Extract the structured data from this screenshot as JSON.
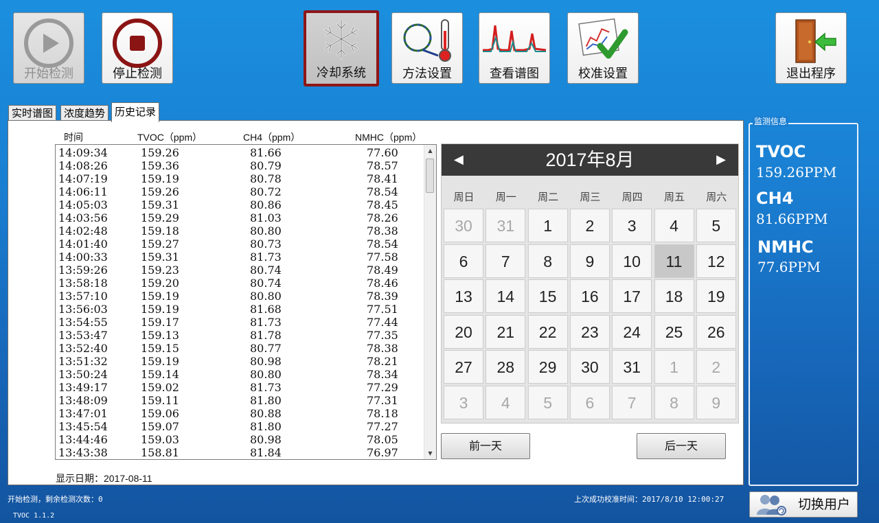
{
  "toolbar": {
    "start": "开始检测",
    "stop": "停止检测",
    "cooling": "冷却系统",
    "method": "方法设置",
    "spectrum": "查看谱图",
    "calibration": "校准设置",
    "exit": "退出程序"
  },
  "tabs": [
    "实时谱图",
    "浓度趋势",
    "历史记录"
  ],
  "history": {
    "columns": [
      "时间",
      "TVOC（ppm）",
      "CH4（ppm）",
      "NMHC（ppm）"
    ],
    "rows": [
      [
        "14:09:34",
        "159.26",
        "81.66",
        "77.60"
      ],
      [
        "14:08:26",
        "159.36",
        "80.79",
        "78.57"
      ],
      [
        "14:07:19",
        "159.19",
        "80.78",
        "78.41"
      ],
      [
        "14:06:11",
        "159.26",
        "80.72",
        "78.54"
      ],
      [
        "14:05:03",
        "159.31",
        "80.86",
        "78.45"
      ],
      [
        "14:03:56",
        "159.29",
        "81.03",
        "78.26"
      ],
      [
        "14:02:48",
        "159.18",
        "80.80",
        "78.38"
      ],
      [
        "14:01:40",
        "159.27",
        "80.73",
        "78.54"
      ],
      [
        "14:00:33",
        "159.31",
        "81.73",
        "77.58"
      ],
      [
        "13:59:26",
        "159.23",
        "80.74",
        "78.49"
      ],
      [
        "13:58:18",
        "159.20",
        "80.74",
        "78.46"
      ],
      [
        "13:57:10",
        "159.19",
        "80.80",
        "78.39"
      ],
      [
        "13:56:03",
        "159.19",
        "81.68",
        "77.51"
      ],
      [
        "13:54:55",
        "159.17",
        "81.73",
        "77.44"
      ],
      [
        "13:53:47",
        "159.13",
        "81.78",
        "77.35"
      ],
      [
        "13:52:40",
        "159.15",
        "80.77",
        "78.38"
      ],
      [
        "13:51:32",
        "159.19",
        "80.98",
        "78.21"
      ],
      [
        "13:50:24",
        "159.14",
        "80.80",
        "78.34"
      ],
      [
        "13:49:17",
        "159.02",
        "81.73",
        "77.29"
      ],
      [
        "13:48:09",
        "159.11",
        "81.80",
        "77.31"
      ],
      [
        "13:47:01",
        "159.06",
        "80.88",
        "78.18"
      ],
      [
        "13:45:54",
        "159.07",
        "81.80",
        "77.27"
      ],
      [
        "13:44:46",
        "159.03",
        "80.98",
        "78.05"
      ],
      [
        "13:43:38",
        "158.81",
        "81.84",
        "76.97"
      ]
    ]
  },
  "display_date": "显示日期：2017-08-11",
  "calendar": {
    "title": "2017年8月",
    "prev_icon": "◀",
    "next_icon": "▶",
    "weekdays": [
      "周日",
      "周一",
      "周二",
      "周三",
      "周四",
      "周五",
      "周六"
    ],
    "days": [
      "30",
      "31",
      "1",
      "2",
      "3",
      "4",
      "5",
      "6",
      "7",
      "8",
      "9",
      "10",
      "11",
      "12",
      "13",
      "14",
      "15",
      "16",
      "17",
      "18",
      "19",
      "20",
      "21",
      "22",
      "23",
      "24",
      "25",
      "26",
      "27",
      "28",
      "29",
      "30",
      "31",
      "1",
      "2",
      "3",
      "4",
      "5",
      "6",
      "7",
      "8",
      "9"
    ],
    "other_month": [
      0,
      1,
      33,
      34,
      35,
      36,
      37,
      38,
      39,
      40,
      41
    ],
    "selected": 12
  },
  "nav": {
    "prev_day": "前一天",
    "next_day": "后一天"
  },
  "monitor": {
    "title": "监测信息",
    "tvoc_label": "TVOC",
    "tvoc_value": "159.26PPM",
    "ch4_label": "CH4",
    "ch4_value": "81.66PPM",
    "nmhc_label": "NMHC",
    "nmhc_value": "77.6PPM"
  },
  "switch_user": "切换用户",
  "status": {
    "left": "开始检测，剩余检测次数：0",
    "calibration": "上次成功校准时间：2017/8/10 12:00:27",
    "version": "TVOC 1.1.2"
  },
  "colors": {
    "background": "#1a7fd2",
    "active_border": "#8e1616",
    "calendar_header": "#393939",
    "selected_day": "#c8c8c8"
  }
}
